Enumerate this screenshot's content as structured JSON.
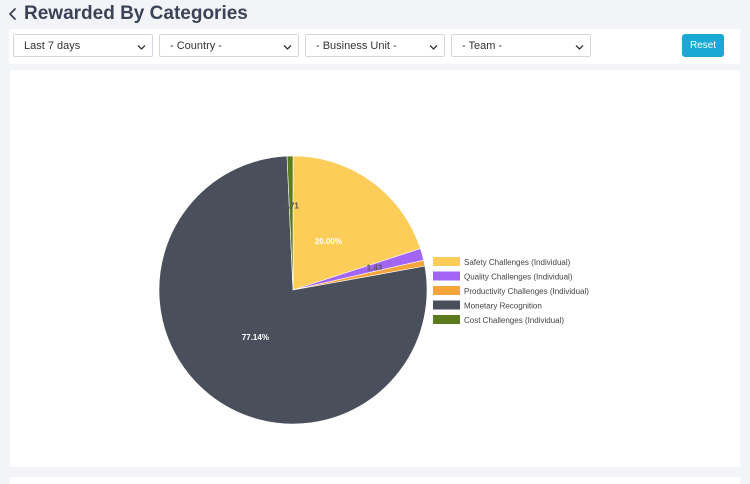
{
  "header": {
    "title": "Rewarded By Categories",
    "back_icon": "chevron-left-icon"
  },
  "filters": {
    "period": {
      "value": "Last 7 days"
    },
    "country": {
      "value": "- Country -"
    },
    "business_unit": {
      "value": "- Business Unit -"
    },
    "team": {
      "value": "- Team -"
    },
    "reset_label": "Reset",
    "chevron_icon": "chevron-down-icon"
  },
  "colors": {
    "accent": "#1aa9d2",
    "background": "#f3f4f8",
    "card": "#ffffff"
  },
  "chart_data": {
    "type": "pie",
    "series": [
      {
        "name": "Safety Challenges (Individual)",
        "value": 20.0,
        "label": "20.00%",
        "color": "#fdcd5a"
      },
      {
        "name": "Quality Challenges (Individual)",
        "value": 1.43,
        "label": "1.43",
        "color": "#a265f5"
      },
      {
        "name": "Productivity Challenges (Individual)",
        "value": 0.72,
        "label": "",
        "color": "#f6a43c"
      },
      {
        "name": "Monetary Recognition",
        "value": 77.14,
        "label": "77.14%",
        "color": "#4a4f5c"
      },
      {
        "name": "Cost Challenges (Individual)",
        "value": 0.71,
        "label": "0.71",
        "color": "#5b7c1c"
      }
    ],
    "legend_position": "right"
  }
}
